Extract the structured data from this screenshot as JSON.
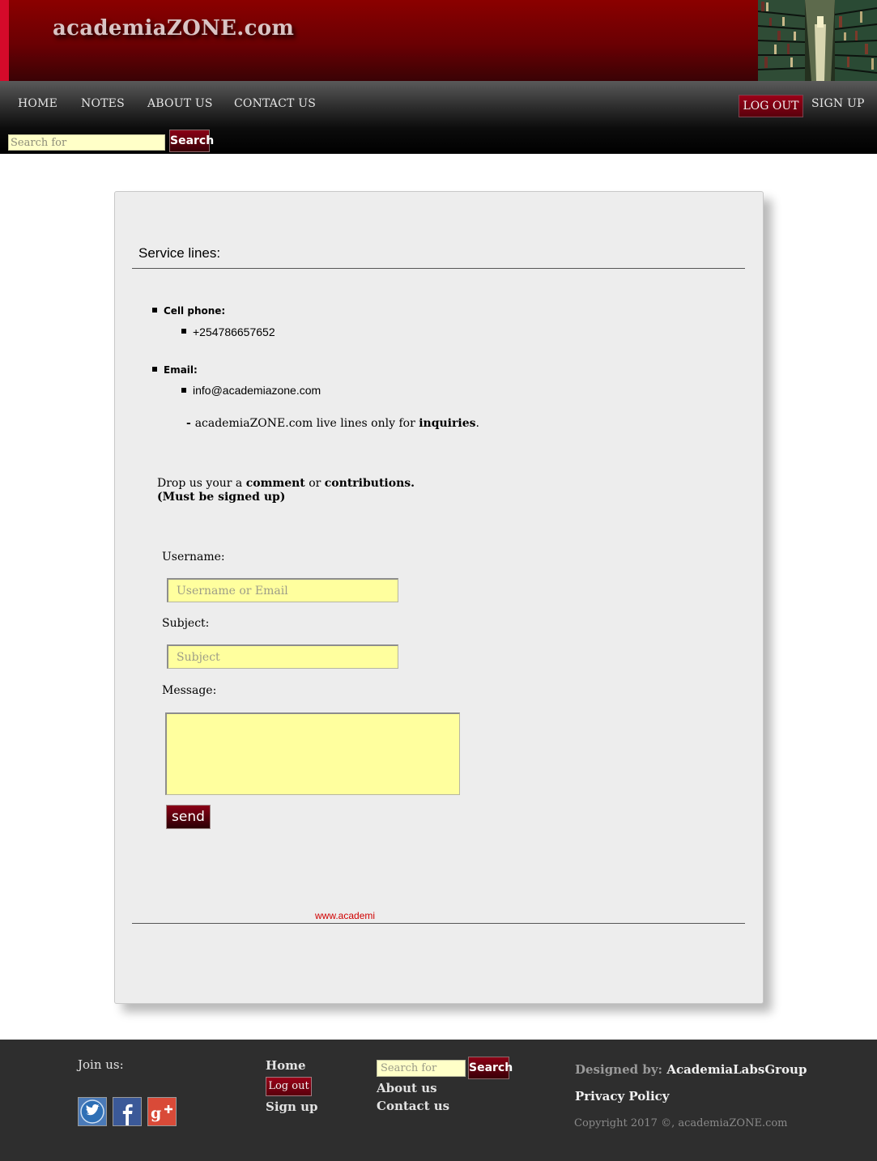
{
  "header": {
    "logo": "academiaZONE.com"
  },
  "nav": {
    "items": [
      "HOME",
      "NOTES",
      "ABOUT US",
      "CONTACT US"
    ],
    "logout": "LOG OUT",
    "signup": "SIGN UP"
  },
  "top_search": {
    "placeholder": "Search for",
    "button": "Search"
  },
  "main": {
    "section_title": "Service lines:",
    "cell_label": "Cell phone:",
    "cell_value": "+254786657652",
    "email_label": "Email:",
    "email_value": "info@academiazone.com",
    "note_prefix": "- ",
    "note_text": "academiaZONE.com live lines only for ",
    "note_bold": "inquiries",
    "note_end": ".",
    "drop_text": "Drop us your a ",
    "drop_bold1": "comment",
    "drop_or": " or ",
    "drop_bold2": "contributions.",
    "drop_line2": "(Must be signed up)",
    "form": {
      "username_label": "Username:",
      "username_placeholder": "Username or Email",
      "subject_label": "Subject:",
      "subject_placeholder": "Subject",
      "message_label": "Message:",
      "send": "send"
    },
    "site_link": "www.academi"
  },
  "footer": {
    "join_label": "Join us:",
    "social_icons": [
      "twitter-icon",
      "facebook-icon",
      "google-plus-icon"
    ],
    "links_col1": {
      "home": "Home",
      "logout": "Log out",
      "signup": "Sign up"
    },
    "search_placeholder": "Search for",
    "search_button": "Search",
    "links_col2": {
      "about": "About us",
      "contact": "Contact us"
    },
    "designed_prefix": "Designed by: ",
    "designed_name": "AcademiaLabsGroup",
    "privacy": "Privacy Policy",
    "copyright": "Copyright 2017 ©, academiaZONE.com"
  },
  "colors": {
    "brand_red": "#8b0000",
    "input_yellow": "#ffff9e",
    "card_bg": "#ededed",
    "footer_bg": "#2e2e2e"
  }
}
